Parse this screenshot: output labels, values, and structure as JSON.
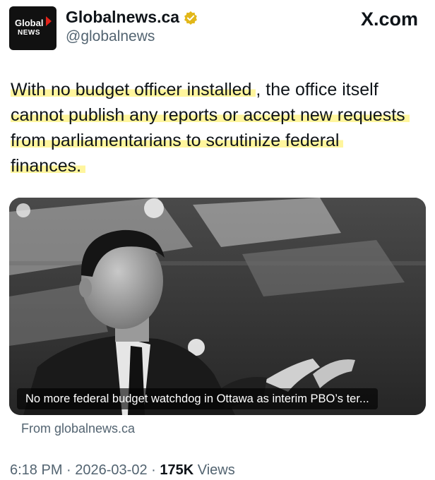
{
  "author": {
    "display_name": "Globalnews.ca",
    "handle": "@globalnews",
    "logo_text_top": "Global",
    "logo_text_bottom": "NEWS",
    "verified": true
  },
  "source_label": "X.com",
  "tweet": {
    "text_highlighted": "With no budget officer installed",
    "text_rest_1": ", the office itself ",
    "text_line2": "cannot publish any reports or accept new requests",
    "text_line3": "from parliamentarians to scrutinize federal",
    "text_line4": "finances."
  },
  "link_card": {
    "image_subject": "man in suit gesturing while speaking",
    "caption": "No more federal budget watchdog in Ottawa as interim PBO’s ter...",
    "source": "From globalnews.ca"
  },
  "meta": {
    "time": "6:18 PM",
    "separator": " · ",
    "date": "2026-03-02",
    "views_count": "175K",
    "views_label": " Views"
  },
  "colors": {
    "highlight": "#fff59d",
    "secondary_text": "#536471",
    "verified_badge": "#e2b719",
    "logo_accent": "#e2231a"
  }
}
